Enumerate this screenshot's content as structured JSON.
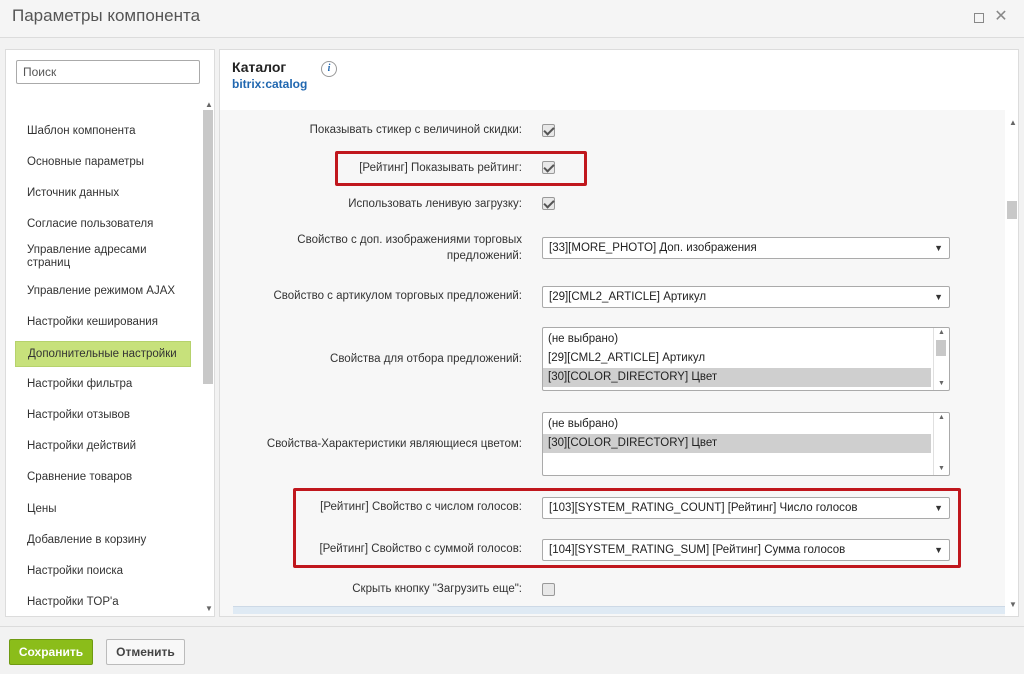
{
  "window": {
    "title": "Параметры компонента"
  },
  "search": {
    "placeholder": "Поиск"
  },
  "sidebar": {
    "items": [
      {
        "label": "Шаблон компонента"
      },
      {
        "label": "Основные параметры"
      },
      {
        "label": "Источник данных"
      },
      {
        "label": "Согласие пользователя"
      },
      {
        "label": "Управление адресами страниц"
      },
      {
        "label": "Управление режимом AJAX"
      },
      {
        "label": "Настройки кеширования"
      },
      {
        "label": "Дополнительные настройки"
      },
      {
        "label": "Настройки фильтра"
      },
      {
        "label": "Настройки отзывов"
      },
      {
        "label": "Настройки действий"
      },
      {
        "label": "Сравнение товаров"
      },
      {
        "label": "Цены"
      },
      {
        "label": "Добавление в корзину"
      },
      {
        "label": "Настройки поиска"
      },
      {
        "label": "Настройки TOP'а"
      }
    ],
    "active_index": 7
  },
  "component": {
    "title": "Каталог",
    "code": "bitrix:catalog",
    "info_icon": "i"
  },
  "settings": {
    "discount_sticker": {
      "label": "Показывать стикер с величиной скидки:",
      "checked": true
    },
    "show_rating": {
      "label": "[Рейтинг] Показывать рейтинг:",
      "checked": true
    },
    "lazy_load": {
      "label": "Использовать ленивую загрузку:",
      "checked": true
    },
    "offer_images": {
      "label": "Свойство с доп. изображениями торговых предложений:",
      "value": "[33][MORE_PHOTO] Доп. изображения"
    },
    "offer_article": {
      "label": "Свойство с артикулом торговых предложений:",
      "value": "[29][CML2_ARTICLE] Артикул"
    },
    "offer_props": {
      "label": "Свойства для отбора предложений:",
      "options": [
        "(не выбрано)",
        "[29][CML2_ARTICLE] Артикул",
        "[30][COLOR_DIRECTORY] Цвет"
      ],
      "selected": [
        2
      ]
    },
    "color_props": {
      "label": "Свойства-Характеристики являющиеся цветом:",
      "options": [
        "(не выбрано)",
        "[30][COLOR_DIRECTORY] Цвет"
      ],
      "selected": [
        1
      ]
    },
    "rating_count": {
      "label": "[Рейтинг] Свойство с числом голосов:",
      "value": "[103][SYSTEM_RATING_COUNT] [Рейтинг] Число голосов"
    },
    "rating_sum": {
      "label": "[Рейтинг] Свойство с суммой голосов:",
      "value": "[104][SYSTEM_RATING_SUM] [Рейтинг] Сумма голосов"
    },
    "hide_load_more": {
      "label": "Скрыть кнопку \"Загрузить еще\":",
      "checked": false
    }
  },
  "footer": {
    "save_label": "Сохранить",
    "cancel_label": "Отменить"
  },
  "colors": {
    "save_button": "#8bbd1a",
    "active_nav": "#c7e17b",
    "highlight": "#c0171d",
    "link": "#2067b0"
  }
}
